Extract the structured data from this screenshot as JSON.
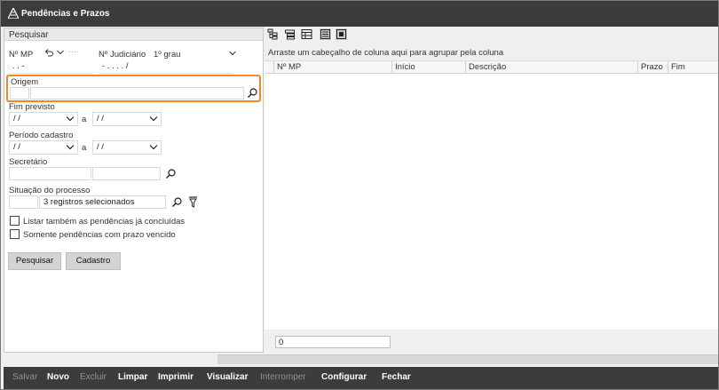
{
  "window": {
    "title": "Pendências e Prazos"
  },
  "search_panel": {
    "header": "Pesquisar",
    "nmp_label": "Nº MP",
    "nmp_value": " .  .       -",
    "judiciario_label": "Nº Judiciário",
    "grau_value": "1º grau",
    "judiciario_value": "-  .  .  .  .   /",
    "origem_label": "Origem",
    "origem_code": "",
    "origem_value": "",
    "fim_previsto_label": "Fim previsto",
    "fim_previsto_from": " / /",
    "fim_previsto_to": " / /",
    "periodo_cadastro_label": "Período cadastro",
    "periodo_from": " / /",
    "periodo_to": " / /",
    "range_sep": "a",
    "secretario_label": "Secretário",
    "secretario_code": "",
    "secretario_name": "",
    "situacao_label": "Situação do processo",
    "situacao_value": "3 registros selecionados",
    "check_concluidas": "Listar também as pendências já concluídas",
    "check_vencido": "Somente pendências com prazo vencido",
    "btn_pesquisar": "Pesquisar",
    "btn_cadastro": "Cadastro",
    "ellipsis": "···"
  },
  "grid": {
    "group_hint": "Arraste um cabeçalho de coluna aqui para agrupar pela coluna",
    "columns": [
      "Nº MP",
      "Início",
      "Descrição",
      "Prazo",
      "Fim"
    ],
    "count": "0"
  },
  "actions": {
    "salvar": "Salvar",
    "novo": "Novo",
    "excluir": "Excluir",
    "limpar": "Limpar",
    "imprimir": "Imprimir",
    "visualizar": "Visualizar",
    "interromper": "Interromper",
    "configurar": "Configurar",
    "fechar": "Fechar"
  },
  "colors": {
    "titlebar": "#3c3c3c",
    "highlight": "#f08a1c",
    "panel_bg": "#f0f0f0"
  }
}
